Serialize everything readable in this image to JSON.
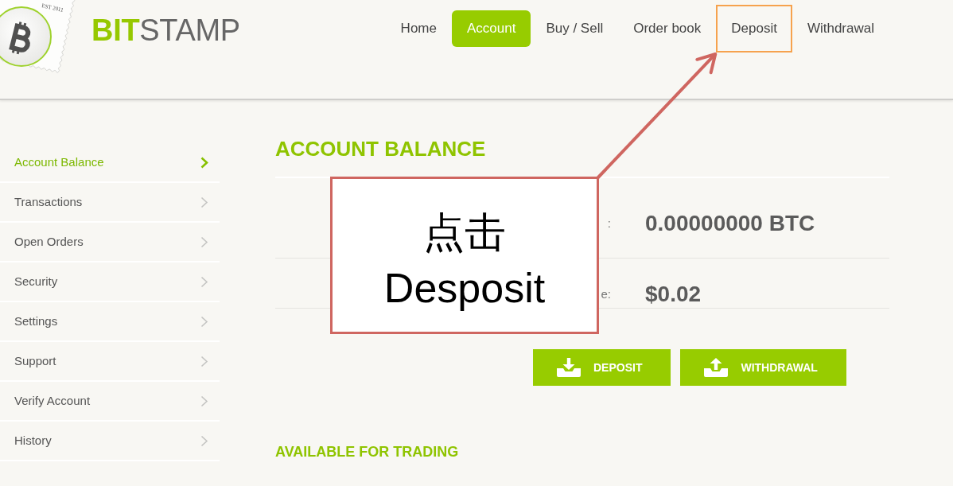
{
  "logo": {
    "badge_text": "EST 2011",
    "brand_bold": "BIT",
    "brand_light": "STAMP"
  },
  "nav": [
    {
      "label": "Home",
      "selected": false,
      "highlighted": false
    },
    {
      "label": "Account",
      "selected": true,
      "highlighted": false
    },
    {
      "label": "Buy / Sell",
      "selected": false,
      "highlighted": false
    },
    {
      "label": "Order book",
      "selected": false,
      "highlighted": false
    },
    {
      "label": "Deposit",
      "selected": false,
      "highlighted": true
    },
    {
      "label": "Withdrawal",
      "selected": false,
      "highlighted": false
    }
  ],
  "sidebar": {
    "items": [
      {
        "label": "Account Balance",
        "selected": true
      },
      {
        "label": "Transactions",
        "selected": false
      },
      {
        "label": "Open Orders",
        "selected": false
      },
      {
        "label": "Security",
        "selected": false
      },
      {
        "label": "Settings",
        "selected": false
      },
      {
        "label": "Support",
        "selected": false
      },
      {
        "label": "Verify Account",
        "selected": false
      },
      {
        "label": "History",
        "selected": false
      }
    ]
  },
  "main": {
    "title": "ACCOUNT BALANCE",
    "balances": [
      {
        "label": ":",
        "value": "0.00000000 BTC"
      },
      {
        "label": "e:",
        "value": "$0.02"
      }
    ],
    "buttons": [
      {
        "label": "DEPOSIT",
        "kind": "deposit"
      },
      {
        "label": "WITHDRAWAL",
        "kind": "withdrawal"
      }
    ],
    "section_title": "AVAILABLE FOR TRADING"
  },
  "annotation": {
    "lines": [
      "点击",
      "Desposit"
    ]
  }
}
